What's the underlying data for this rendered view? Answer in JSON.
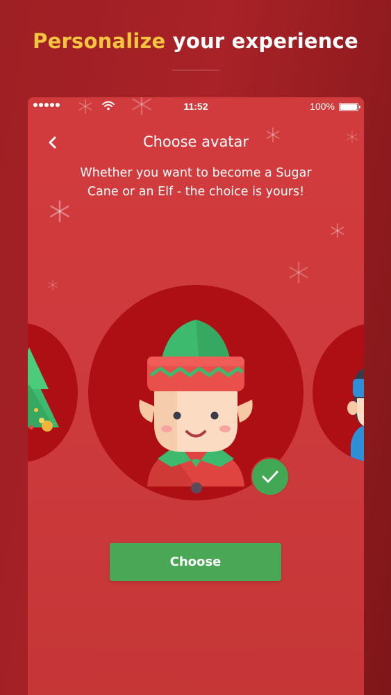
{
  "headline": {
    "accent": "Personalize",
    "rest": " your experience"
  },
  "status_bar": {
    "time": "11:52",
    "battery": "100%",
    "icons": [
      "signal-dots-icon",
      "wifi-icon",
      "battery-icon"
    ]
  },
  "screen": {
    "back_icon": "chevron-left-icon",
    "title": "Choose avatar",
    "subtitle_line1": "Whether you want to become a Sugar",
    "subtitle_line2": "Cane or an Elf - the choice is yours!"
  },
  "avatars": [
    {
      "name": "christmas-tree-avatar",
      "selected": false
    },
    {
      "name": "elf-avatar",
      "selected": true
    },
    {
      "name": "character-avatar",
      "selected": false
    }
  ],
  "choose_button": "Choose",
  "colors": {
    "background": "#a82227",
    "accent_yellow": "#f6c540",
    "panel": "#cd3a3d",
    "avatar_bg": "#ad0f14",
    "button_green": "#4aa755"
  }
}
